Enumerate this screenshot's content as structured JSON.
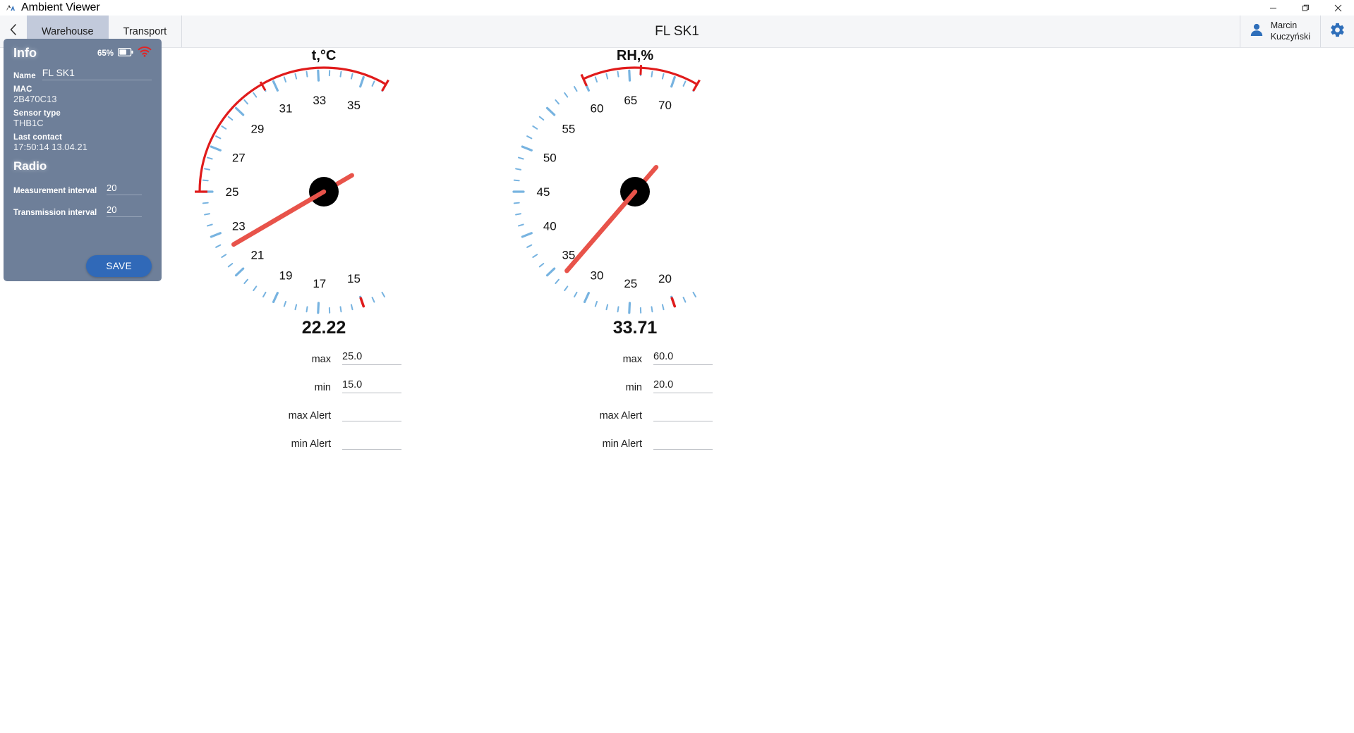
{
  "window": {
    "app_title": "Ambient Viewer",
    "app_icon": "ambient-viewer-logo-icon",
    "minimize_icon": "minimize-icon",
    "maximize_icon": "maximize-restore-icon",
    "close_icon": "close-icon"
  },
  "header": {
    "back_icon": "chevron-left-icon",
    "title": "FL SK1",
    "tabs": [
      {
        "label": "Warehouse",
        "active": true
      },
      {
        "label": "Transport",
        "active": false
      }
    ],
    "user": {
      "first_name": "Marcin",
      "last_name": "Kuczyński",
      "avatar_icon": "person-icon"
    },
    "settings_icon": "gear-icon"
  },
  "sidebar": {
    "title": "Info",
    "battery": {
      "percent": "65%",
      "icon": "battery-icon"
    },
    "wifi_icon": "wifi-icon",
    "name_label": "Name",
    "name_value": "FL SK1",
    "mac_label": "MAC",
    "mac_value": "2B470C13",
    "sensor_type_label": "Sensor type",
    "sensor_type_value": "THB1C",
    "last_contact_label": "Last contact",
    "last_contact_value": "17:50:14 13.04.21",
    "radio_title": "Radio",
    "measurement_interval_label": "Measurement interval",
    "measurement_interval_value": "20",
    "transmission_interval_label": "Transmission interval",
    "transmission_interval_value": "20",
    "save_label": "SAVE",
    "colors": {
      "panel": "#6e7f99",
      "save_button": "#3069b8"
    }
  },
  "chart_data": [
    {
      "type": "gauge",
      "name": "temperature-gauge",
      "title": "t,°C",
      "value": "22.22",
      "value_number": 22.22,
      "scale_min": 14,
      "scale_max": 36,
      "tick_labels": [
        "15",
        "17",
        "19",
        "21",
        "23",
        "25",
        "27",
        "29",
        "31",
        "33",
        "35"
      ],
      "tick_values": [
        15,
        17,
        19,
        21,
        23,
        25,
        27,
        29,
        31,
        33,
        35
      ],
      "minor_tick_step": 0.5,
      "alarm_arc": {
        "from": 25.0,
        "to": 36.0,
        "color": "#e01b1b"
      },
      "limit_marker_low": 15.0,
      "needle_color": "#e8534a",
      "tick_color": "#77b3e0",
      "fields": [
        {
          "label": "max",
          "value": "25.0",
          "placeholder": ""
        },
        {
          "label": "min",
          "value": "15.0",
          "placeholder": ""
        },
        {
          "label": "max Alert",
          "value": "",
          "placeholder": ""
        },
        {
          "label": "min Alert",
          "value": "",
          "placeholder": ""
        }
      ]
    },
    {
      "type": "gauge",
      "name": "humidity-gauge",
      "title": "RH,%",
      "value": "33.71",
      "value_number": 33.71,
      "scale_min": 17.5,
      "scale_max": 72.5,
      "tick_labels": [
        "20",
        "25",
        "30",
        "35",
        "40",
        "45",
        "50",
        "55",
        "60",
        "65",
        "70"
      ],
      "tick_values": [
        20,
        25,
        30,
        35,
        40,
        45,
        50,
        55,
        60,
        65,
        70
      ],
      "minor_tick_step": 1.25,
      "alarm_arc": {
        "from": 60.0,
        "to": 72.5,
        "color": "#e01b1b"
      },
      "limit_marker_low": 20.0,
      "needle_color": "#e8534a",
      "tick_color": "#77b3e0",
      "fields": [
        {
          "label": "max",
          "value": "60.0",
          "placeholder": ""
        },
        {
          "label": "min",
          "value": "20.0",
          "placeholder": ""
        },
        {
          "label": "max Alert",
          "value": "",
          "placeholder": ""
        },
        {
          "label": "min Alert",
          "value": "",
          "placeholder": ""
        }
      ]
    }
  ]
}
